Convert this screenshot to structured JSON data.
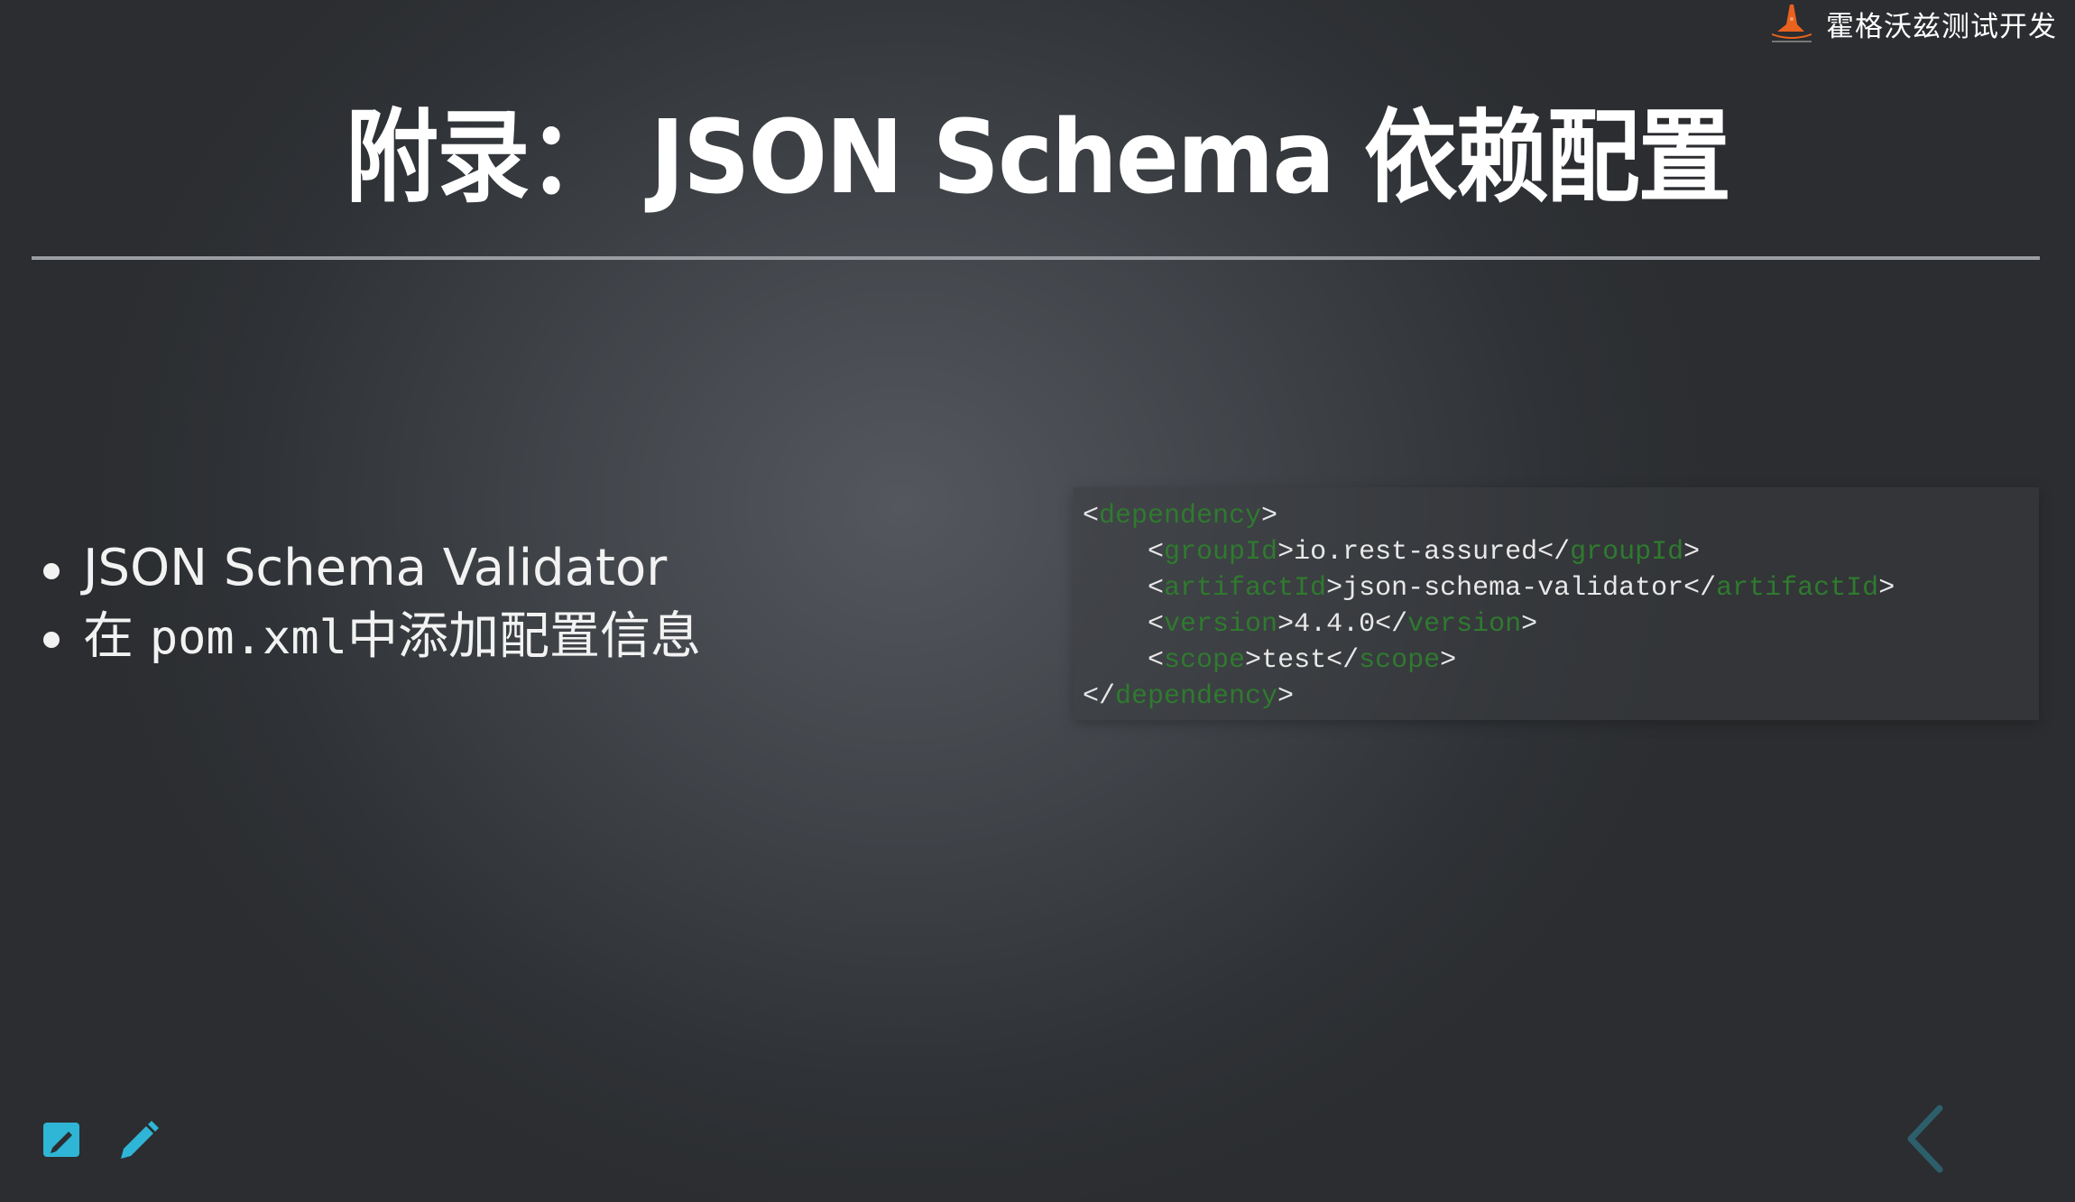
{
  "brand": {
    "name": "霍格沃兹测试开发",
    "logo_icon": "wizard-hat-icon",
    "accent_color": "#e9621e"
  },
  "slide": {
    "title": "附录： JSON Schema 依赖配置",
    "bullets": {
      "first": "JSON Schema Validator",
      "second_prefix": "在 ",
      "second_code": "pom.xml",
      "second_suffix": "中添加配置信息"
    },
    "code": {
      "open_bracket": "<",
      "close_bracket": ">",
      "end_open": "</",
      "dependency_tag": "dependency",
      "group_tag": "groupId",
      "group_value": "io.rest-assured",
      "artifact_tag": "artifactId",
      "artifact_value": "json-schema-validator",
      "version_tag": "version",
      "version_value": "4.4.0",
      "scope_tag": "scope",
      "scope_value": "test",
      "indent": "    ",
      "tag_color": "#2f7a2f"
    }
  },
  "controls": {
    "sketch_icon": "sketch-board-icon",
    "pen_icon": "pencil-icon",
    "prev_icon": "chevron-left-icon",
    "icon_color": "#2fb5d6",
    "nav_color": "#2d5f6b"
  }
}
